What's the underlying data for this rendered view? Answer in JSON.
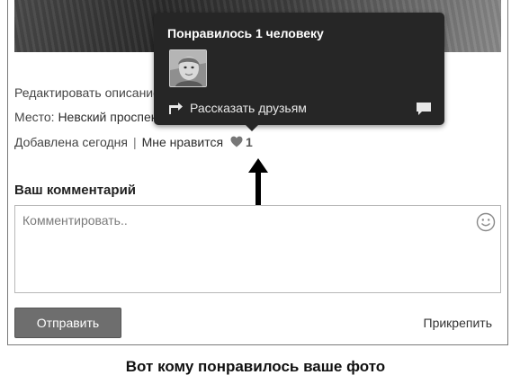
{
  "photo_info": {
    "edit_description": "Редактировать описание",
    "place_label": "Место:",
    "place_value": "Невский проспект, Санкт-Петербург",
    "added": "Добавлена сегодня",
    "separator": "|",
    "likes_label": "Мне нравится",
    "likes_count": "1"
  },
  "likes_popup": {
    "title": "Понравилось 1 человеку",
    "share_label": "Рассказать друзьям",
    "icons": [
      "share-arrow-icon",
      "comment-bubble-icon"
    ]
  },
  "comment": {
    "heading": "Ваш комментарий",
    "placeholder": "Комментировать..",
    "value": "",
    "send_label": "Отправить",
    "attach_label": "Прикрепить"
  },
  "caption": "Вот кому понравилось ваше фото",
  "colors": {
    "popup_bg": "#262626",
    "button_bg": "#6e6e6e",
    "text": "#444444"
  }
}
